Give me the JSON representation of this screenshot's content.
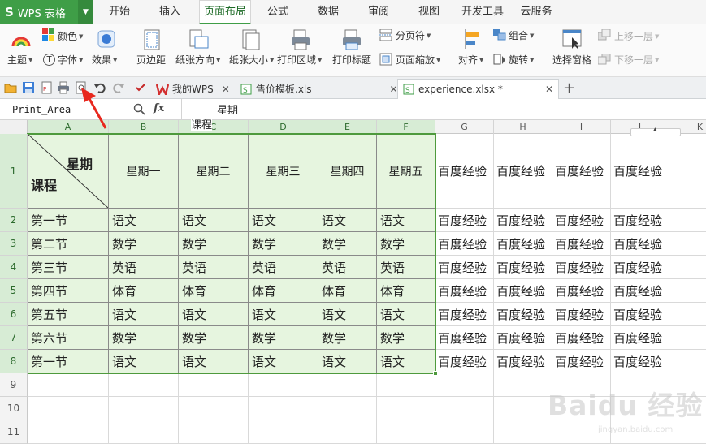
{
  "app": {
    "logo": "S",
    "title": "WPS 表格"
  },
  "menu": {
    "tabs": [
      "开始",
      "插入",
      "页面布局",
      "公式",
      "数据",
      "审阅",
      "视图",
      "开发工具",
      "云服务"
    ],
    "active": "页面布局"
  },
  "ribbon": {
    "theme": "主题",
    "colors": "颜色",
    "fonts": "字体",
    "effects": "效果",
    "margins": "页边距",
    "orientation": "纸张方向",
    "paper_size": "纸张大小",
    "print_area": "打印区域",
    "print_titles": "打印标题",
    "page_break": "分页符",
    "page_zoom": "页面缩放",
    "align": "对齐",
    "group": "组合",
    "rotate": "旋转",
    "selection_pane": "选择窗格",
    "bring_forward": "上移一层",
    "send_backward": "下移一层",
    "font_badge": "T"
  },
  "doc_tabs": [
    {
      "label": "我的WPS"
    },
    {
      "label": "售价模板.xls"
    },
    {
      "label": "experience.xlsx *"
    }
  ],
  "formula_bar": {
    "name_box": "Print_Area",
    "fx": "fx",
    "line1": "星期",
    "line2": "课程"
  },
  "sheet": {
    "columns": [
      "A",
      "B",
      "C",
      "D",
      "E",
      "F",
      "G",
      "H",
      "I",
      "J",
      "K"
    ],
    "rows": [
      "1",
      "2",
      "3",
      "4",
      "5",
      "6",
      "7",
      "8",
      "9",
      "10",
      "11"
    ],
    "corner_top": "星期",
    "corner_bottom": "课程",
    "headers": [
      "星期一",
      "星期二",
      "星期三",
      "星期四",
      "星期五"
    ],
    "periods": [
      "第一节",
      "第二节",
      "第三节",
      "第四节",
      "第五节",
      "第六节",
      "第一节"
    ],
    "schedule": [
      [
        "语文",
        "语文",
        "语文",
        "语文",
        "语文"
      ],
      [
        "数学",
        "数学",
        "数学",
        "数学",
        "数学"
      ],
      [
        "英语",
        "英语",
        "英语",
        "英语",
        "英语"
      ],
      [
        "体育",
        "体育",
        "体育",
        "体育",
        "体育"
      ],
      [
        "语文",
        "语文",
        "语文",
        "语文",
        "语文"
      ],
      [
        "数学",
        "数学",
        "数学",
        "数学",
        "数学"
      ],
      [
        "语文",
        "语文",
        "语文",
        "语文",
        "语文"
      ]
    ],
    "extra_text": "百度经验"
  },
  "watermark": {
    "main": "Baidu 经验",
    "sub": "jingyan.baidu.com"
  },
  "colors": {
    "brand": "#3f9e47",
    "table_fill": "#e6f5df",
    "selection": "#4e9a3d",
    "arrow": "#e8281e"
  }
}
